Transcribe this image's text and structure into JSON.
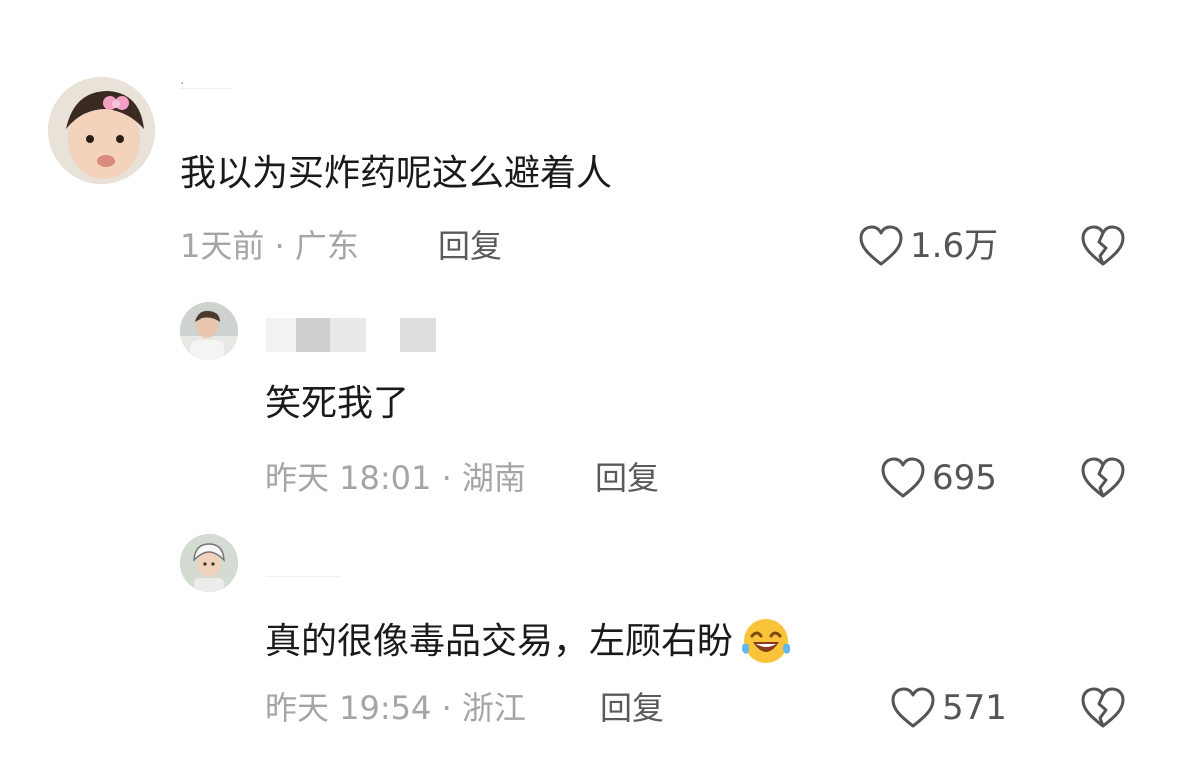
{
  "comments": [
    {
      "username": "·",
      "text": "我以为买炸药呢这么避着人",
      "time": "1天前",
      "separator": "·",
      "location": "广东",
      "reply_label": "回复",
      "likes": "1.6万"
    },
    {
      "username": "",
      "text": "笑死我了",
      "time": "昨天 18:01",
      "separator": "·",
      "location": "湖南",
      "reply_label": "回复",
      "likes": "695"
    },
    {
      "username": "",
      "text": "真的很像毒品交易，左顾右盼",
      "time": "昨天 19:54",
      "separator": "·",
      "location": "浙江",
      "reply_label": "回复",
      "likes": "571"
    }
  ],
  "icons": {
    "like": "heart-outline-icon",
    "dislike": "broken-heart-icon",
    "emoji": "laughing-tears-emoji-icon"
  },
  "colors": {
    "text": "#1a1a1a",
    "meta": "#a5a5a5",
    "reply": "#5a5a5a",
    "icon": "#555555"
  }
}
